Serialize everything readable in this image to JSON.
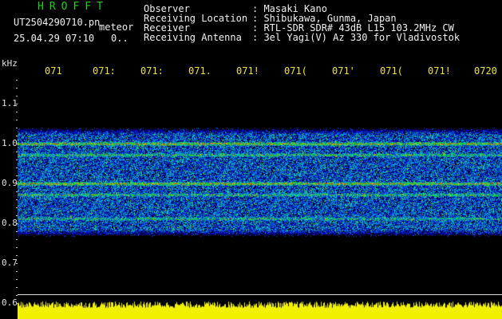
{
  "header": {
    "app_title": "HROFFT",
    "filename": "UT2504290710.pn",
    "mode": "meteor",
    "timestamp": "25.04.29 07:10",
    "timestamp_suffix": "0..",
    "info": [
      {
        "key": "Observer",
        "value": ": Masaki Kano"
      },
      {
        "key": "Receiving Location",
        "value": ": Shibukawa, Gunma, Japan"
      },
      {
        "key": "Receiver",
        "value": ": RTL-SDR SDR# 43dB L15 103.2MHz CW"
      },
      {
        "key": "Receiving Antenna",
        "value": ": 3el Yagi(V) Az 330 for Vladivostok"
      }
    ]
  },
  "axis": {
    "unit": "kHz",
    "freq_labels": [
      "1.1",
      "1.0",
      "0.9",
      "0.8",
      "0.7",
      "0.6"
    ],
    "time_labels": [
      "071",
      "071:",
      "071:",
      "071.",
      "071!",
      "071(",
      "071'",
      "071(",
      "071!",
      "0720"
    ]
  },
  "colors": {
    "background": "#000000",
    "title": "#19d219",
    "time_labels": "#f0e040",
    "amplitude_bar": "#f0f000"
  }
}
